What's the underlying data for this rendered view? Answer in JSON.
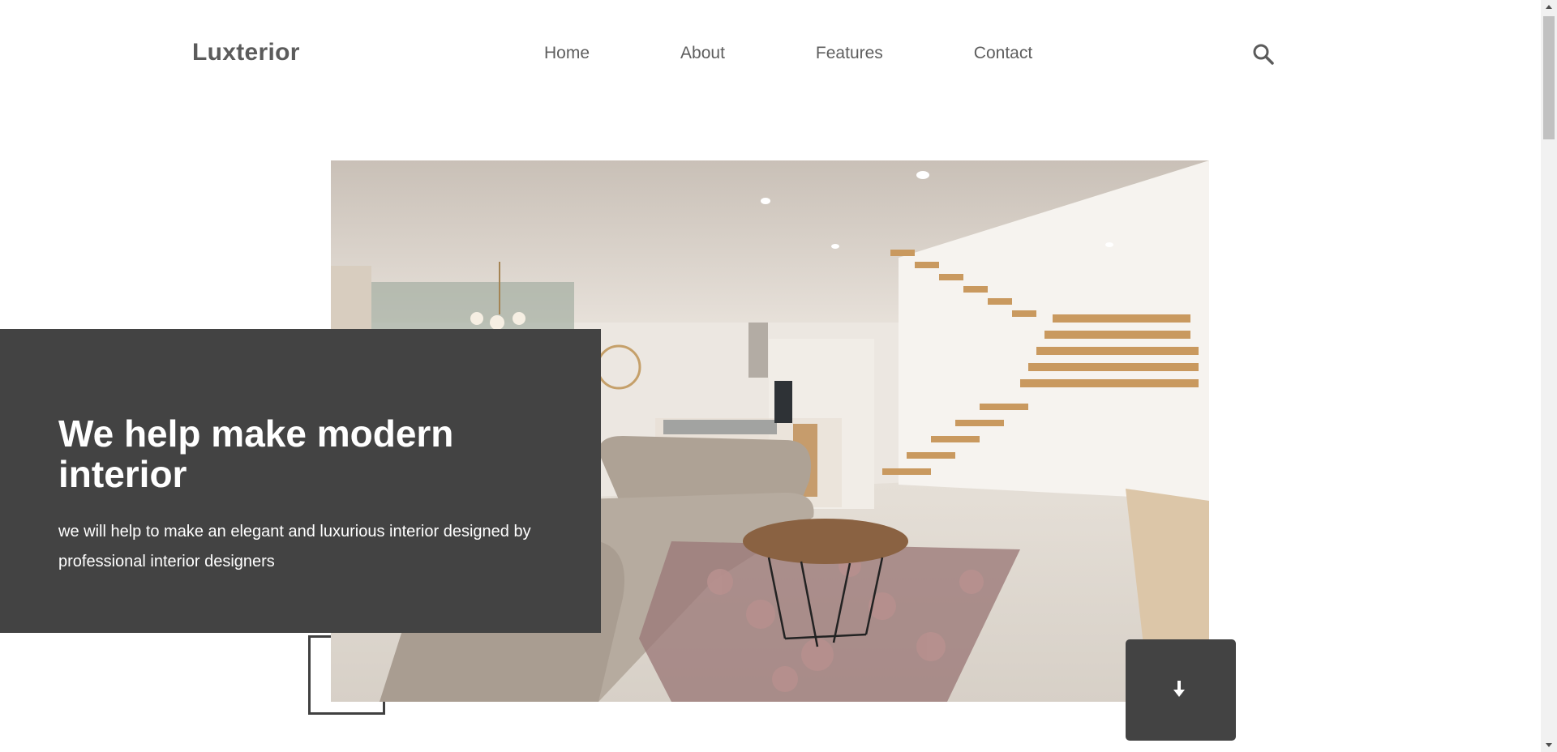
{
  "brand": {
    "name": "Luxterior"
  },
  "nav": {
    "items": [
      {
        "label": "Home"
      },
      {
        "label": "About"
      },
      {
        "label": "Features"
      },
      {
        "label": "Contact"
      }
    ]
  },
  "header": {
    "search_icon": "search-icon"
  },
  "hero": {
    "title": "We help make modern interior",
    "subtitle": "we will help to make an elegant and luxurious interior designed by professional interior designers",
    "scroll_icon": "arrow-down-icon"
  },
  "colors": {
    "dark_panel": "#434343",
    "text": "#5a5a5a",
    "background": "#ffffff"
  }
}
